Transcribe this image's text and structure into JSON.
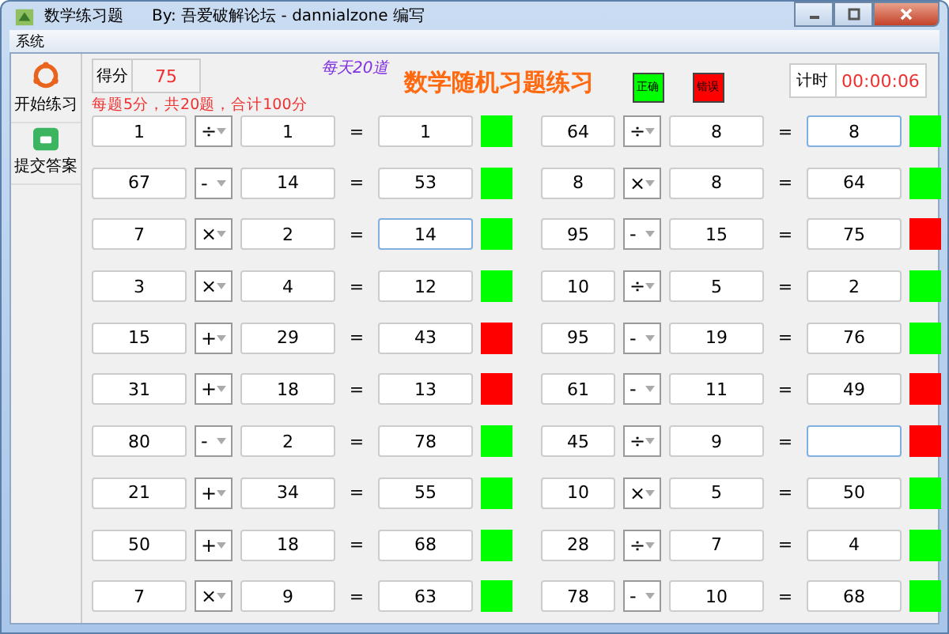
{
  "window": {
    "title": "数学练习题",
    "subtitle": "By: 吾爱破解论坛 - dannialzone 编写"
  },
  "menu": [
    "系统"
  ],
  "sidebar": [
    {
      "label": "开始练习"
    },
    {
      "label": "提交答案"
    }
  ],
  "score": {
    "label": "得分",
    "value": "75"
  },
  "slogan": "每天20道",
  "heading": "数学随机习题练习",
  "rule": "每题5分，共20题，合计100分",
  "legend": [
    {
      "label": "正确",
      "correct": true
    },
    {
      "label": "错误",
      "correct": false
    }
  ],
  "timer": {
    "label": "计时",
    "value": "00:00:06"
  },
  "problems": [
    {
      "a": "1",
      "op": "÷",
      "b": "1",
      "answer": "1",
      "correct": true,
      "focused": false
    },
    {
      "a": "64",
      "op": "÷",
      "b": "8",
      "answer": "8",
      "correct": true,
      "focused": true
    },
    {
      "a": "67",
      "op": "-",
      "b": "14",
      "answer": "53",
      "correct": true,
      "focused": false
    },
    {
      "a": "8",
      "op": "×",
      "b": "8",
      "answer": "64",
      "correct": true,
      "focused": false
    },
    {
      "a": "7",
      "op": "×",
      "b": "2",
      "answer": "14",
      "correct": true,
      "focused": true
    },
    {
      "a": "95",
      "op": "-",
      "b": "15",
      "answer": "75",
      "correct": false,
      "focused": false
    },
    {
      "a": "3",
      "op": "×",
      "b": "4",
      "answer": "12",
      "correct": true,
      "focused": false
    },
    {
      "a": "10",
      "op": "÷",
      "b": "5",
      "answer": "2",
      "correct": true,
      "focused": false
    },
    {
      "a": "15",
      "op": "+",
      "b": "29",
      "answer": "43",
      "correct": false,
      "focused": false
    },
    {
      "a": "95",
      "op": "-",
      "b": "19",
      "answer": "76",
      "correct": true,
      "focused": false
    },
    {
      "a": "31",
      "op": "+",
      "b": "18",
      "answer": "13",
      "correct": false,
      "focused": false
    },
    {
      "a": "61",
      "op": "-",
      "b": "11",
      "answer": "49",
      "correct": false,
      "focused": false
    },
    {
      "a": "80",
      "op": "-",
      "b": "2",
      "answer": "78",
      "correct": true,
      "focused": false
    },
    {
      "a": "45",
      "op": "÷",
      "b": "9",
      "correct": false,
      "focused": true
    },
    {
      "a": "21",
      "op": "+",
      "b": "34",
      "answer": "55",
      "correct": true,
      "focused": false
    },
    {
      "a": "10",
      "op": "×",
      "b": "5",
      "answer": "50",
      "correct": true,
      "focused": false
    },
    {
      "a": "50",
      "op": "+",
      "b": "18",
      "answer": "68",
      "correct": true,
      "focused": false
    },
    {
      "a": "28",
      "op": "÷",
      "b": "7",
      "answer": "4",
      "correct": true,
      "focused": false
    },
    {
      "a": "7",
      "op": "×",
      "b": "9",
      "answer": "63",
      "correct": true,
      "focused": false
    },
    {
      "a": "78",
      "op": "-",
      "b": "10",
      "answer": "68",
      "correct": true,
      "focused": false
    }
  ],
  "equals": "="
}
